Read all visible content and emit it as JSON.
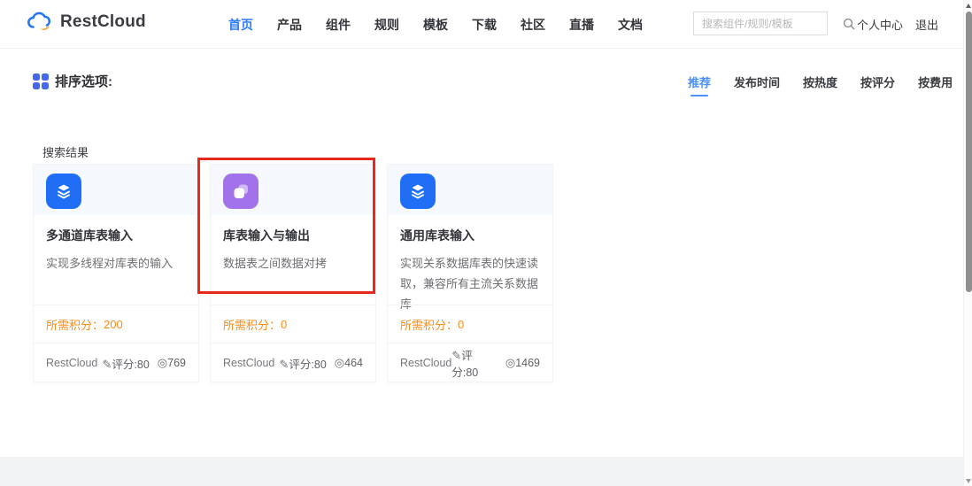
{
  "header": {
    "brand": "RestCloud",
    "nav": [
      {
        "label": "首页",
        "active": true
      },
      {
        "label": "产品"
      },
      {
        "label": "组件"
      },
      {
        "label": "规则"
      },
      {
        "label": "模板"
      },
      {
        "label": "下载"
      },
      {
        "label": "社区"
      },
      {
        "label": "直播"
      },
      {
        "label": "文档"
      }
    ],
    "search": {
      "placeholder": "搜索组件/规则/模板",
      "value": ""
    },
    "user_center": "个人中心",
    "logout": "退出"
  },
  "sort": {
    "label": "排序选项:",
    "options": [
      {
        "label": "推荐",
        "active": true
      },
      {
        "label": "发布时间"
      },
      {
        "label": "按热度"
      },
      {
        "label": "按评分"
      },
      {
        "label": "按费用"
      }
    ]
  },
  "results": {
    "section_label": "搜索结果",
    "points_label": "所需积分：",
    "cards": [
      {
        "icon": "database-stack-icon",
        "title": "多通道库表输入",
        "description": "实现多线程对库表的输入",
        "points": "200",
        "vendor": "RestCloud",
        "rating": "评分:80",
        "views": "769"
      },
      {
        "icon": "copy-squares-icon",
        "title": "库表输入与输出",
        "description": "数据表之间数据对拷",
        "points": "0",
        "vendor": "RestCloud",
        "rating": "评分:80",
        "views": "464",
        "highlighted": true
      },
      {
        "icon": "database-stack-icon",
        "title": "通用库表输入",
        "description": "实现关系数据库表的快速读取，兼容所有主流关系数据库",
        "points": "0",
        "vendor": "RestCloud",
        "rating": "评分:80",
        "views": "1469"
      }
    ]
  },
  "colors": {
    "accent_blue": "#2e7cf6",
    "sort_active_blue": "#4a90f8",
    "points_orange": "#fa8c16",
    "highlight_red": "#e52a1d",
    "icon_blue": "#1f6ef5",
    "icon_purple": "#a172ea"
  }
}
